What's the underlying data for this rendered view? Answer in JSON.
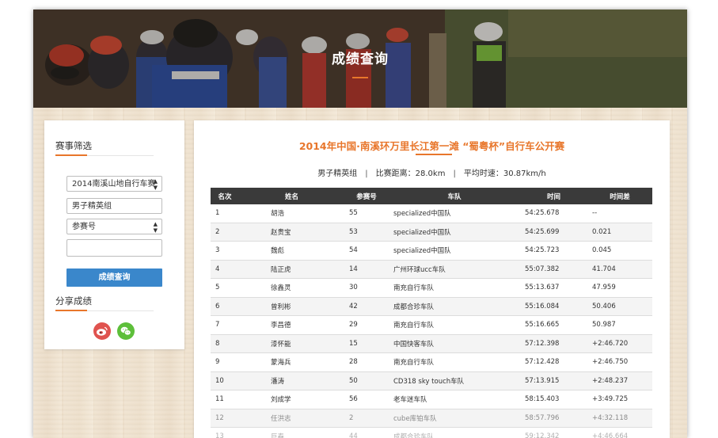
{
  "banner": {
    "title": "成绩查询"
  },
  "sidebar": {
    "filter_heading": "赛事筛选",
    "race_select": "2014南溪山地自行车赛",
    "group_value": "男子精英组",
    "search_type_select": "参赛号",
    "search_input_value": "",
    "query_button": "成绩查询",
    "share_heading": "分享成绩",
    "share_icons": [
      "weibo-icon",
      "wechat-icon"
    ]
  },
  "main": {
    "event_title": "2014年中国·南溪环万里长江第一滩 “蜀粤杯”自行车公开赛",
    "summary": {
      "group": "男子精英组",
      "distance": "比赛距离：28.0km",
      "avg_speed": "平均时速：30.87km/h"
    },
    "table": {
      "headers": [
        "名次",
        "姓名",
        "参赛号",
        "车队",
        "时间",
        "时间差"
      ],
      "rows": [
        [
          "1",
          "胡浩",
          "55",
          "specialized中国队",
          "54:25.678",
          "--"
        ],
        [
          "2",
          "赵贵宝",
          "53",
          "specialized中国队",
          "54:25.699",
          "0.021"
        ],
        [
          "3",
          "魏彪",
          "54",
          "specialized中国队",
          "54:25.723",
          "0.045"
        ],
        [
          "4",
          "陆正虎",
          "14",
          "广州环球ucc车队",
          "55:07.382",
          "41.704"
        ],
        [
          "5",
          "徐鑫灵",
          "30",
          "南充自行车队",
          "55:13.637",
          "47.959"
        ],
        [
          "6",
          "曾利彬",
          "42",
          "成都合珍车队",
          "55:16.084",
          "50.406"
        ],
        [
          "7",
          "李昌德",
          "29",
          "南充自行车队",
          "55:16.665",
          "50.987"
        ],
        [
          "8",
          "漆怀能",
          "15",
          "中国快客车队",
          "57:12.398",
          "+2:46.720"
        ],
        [
          "9",
          "蒙海兵",
          "28",
          "南充自行车队",
          "57:12.428",
          "+2:46.750"
        ],
        [
          "10",
          "潘涛",
          "50",
          "CD318 sky touch车队",
          "57:13.915",
          "+2:48.237"
        ],
        [
          "11",
          "刘成学",
          "56",
          "老车迷车队",
          "58:15.403",
          "+3:49.725"
        ],
        [
          "12",
          "任洪志",
          "2",
          "cube库铂车队",
          "58:57.796",
          "+4:32.118"
        ],
        [
          "13",
          "巨春",
          "44",
          "成都合珍车队",
          "59:12.342",
          "+4:46.664"
        ]
      ]
    }
  },
  "colors": {
    "accent": "#e8762b",
    "button_blue": "#3a87cb",
    "table_header": "#3a3a3a",
    "weibo": "#e0534f",
    "wechat": "#5dbf3a"
  }
}
